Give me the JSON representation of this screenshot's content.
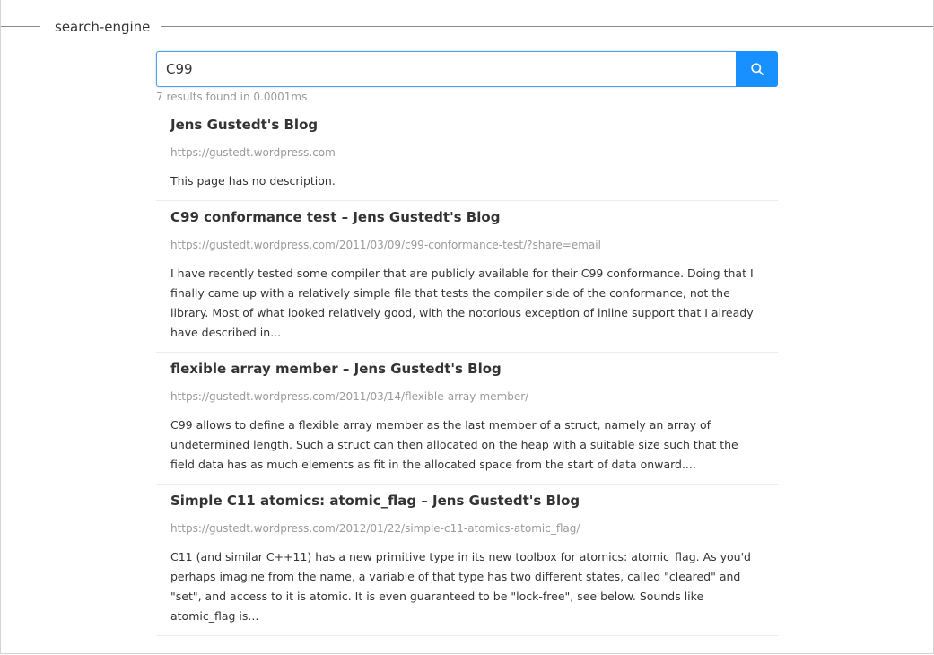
{
  "header": {
    "title": "search-engine"
  },
  "search": {
    "value": "C99",
    "button_icon": "search-icon",
    "accent_color": "#1890ff"
  },
  "results_meta": "7 results found in 0.0001ms",
  "results": [
    {
      "title": "Jens Gustedt's Blog",
      "url": "https://gustedt.wordpress.com",
      "description": "This page has no description."
    },
    {
      "title": "C99 conformance test – Jens Gustedt's Blog",
      "url": "https://gustedt.wordpress.com/2011/03/09/c99-conformance-test/?share=email",
      "description": "I have recently tested some compiler that are publicly available for their C99 conformance. Doing that I finally came up with a relatively simple file that tests the compiler side of the conformance, not the library. Most of what looked relatively good, with the notorious exception of inline support that I already have described in..."
    },
    {
      "title": "flexible array member – Jens Gustedt's Blog",
      "url": "https://gustedt.wordpress.com/2011/03/14/flexible-array-member/",
      "description": "C99 allows to define a flexible array member as the last member of a struct, namely an array of undetermined length. Such a struct can then allocated on the heap with a suitable size such that the field data has as much elements as fit in the allocated space from the start of data onward...."
    },
    {
      "title": "Simple C11 atomics: atomic_flag – Jens Gustedt's Blog",
      "url": "https://gustedt.wordpress.com/2012/01/22/simple-c11-atomics-atomic_flag/",
      "description": "C11 (and similar C++11) has a new primitive type in its new toolbox for atomics: atomic_flag. As you'd perhaps imagine from the name, a variable of that type has two different states, called \"cleared\" and \"set\", and access to it is atomic. It is even guaranteed to be \"lock-free\", see below. Sounds like atomic_flag is..."
    }
  ]
}
